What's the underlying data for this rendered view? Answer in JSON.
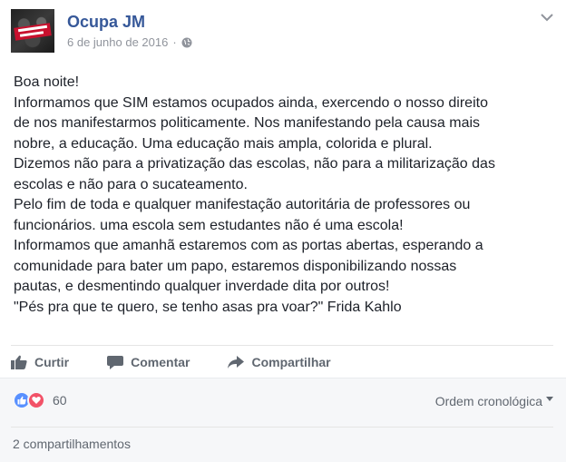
{
  "post": {
    "page_name": "Ocupa JM",
    "date": "6 de junho de 2016",
    "separator": "·",
    "avatar_icon": "page-avatar-image",
    "privacy_icon": "globe-icon",
    "menu_icon": "chevron-down-icon",
    "lines": [
      "Boa noite!",
      "Informamos que SIM estamos ocupados ainda, exercendo o nosso direito",
      "de nos manifestarmos politicamente. Nos manifestando pela causa mais",
      "nobre, a educação. Uma educação mais ampla, colorida e plural.",
      "Dizemos não para a privatização das escolas, não para a militarização das",
      "escolas e não para o sucateamento.",
      "Pelo fim de toda e qualquer manifestação autoritária de professores ou",
      "funcionários. uma escola sem estudantes não é uma escola!",
      "Informamos que amanhã estaremos com as portas abertas, esperando a",
      "comunidade para bater um papo, estaremos disponibilizando nossas",
      "pautas, e desmentindo qualquer inverdade dita por outros!",
      "\"Pés pra que te quero, se tenho asas pra voar?\" Frida Kahlo"
    ]
  },
  "actions": {
    "like_label": "Curtir",
    "comment_label": "Comentar",
    "share_label": "Compartilhar"
  },
  "reactions": {
    "count": "60",
    "types": [
      "like",
      "love"
    ]
  },
  "comments": {
    "order_label": "Ordem cronológica"
  },
  "shares": {
    "label": "2 compartilhamentos"
  },
  "colors": {
    "link": "#365899",
    "text": "#1d2129",
    "muted": "#90949c",
    "action": "#606770",
    "like": "#5890ff",
    "love": "#f25268"
  }
}
